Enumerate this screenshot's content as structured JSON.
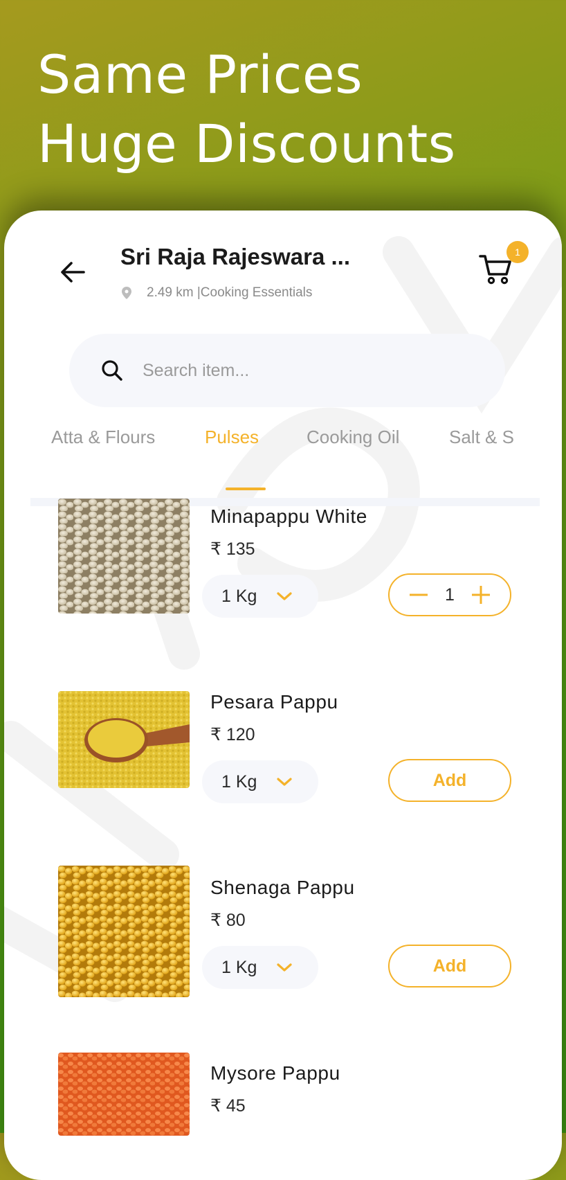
{
  "headline": {
    "line1": "Same Prices",
    "line2": "Huge Discounts"
  },
  "header": {
    "store_name": "Sri Raja Rajeswara ...",
    "store_meta": "2.49 km |Cooking Essentials",
    "cart_count": "1"
  },
  "search": {
    "placeholder": "Search item...",
    "value": ""
  },
  "tabs": [
    {
      "label": "Atta & Flours",
      "active": false
    },
    {
      "label": "Pulses",
      "active": true
    },
    {
      "label": "Cooking Oil",
      "active": false
    },
    {
      "label": "Salt & S",
      "active": false
    }
  ],
  "products": [
    {
      "name": "Minapappu White",
      "price": "₹ 135",
      "size": "1 Kg",
      "quantity": "1",
      "in_cart": true,
      "image": "white-urad-dal"
    },
    {
      "name": "Pesara Pappu",
      "price": "₹ 120",
      "size": "1 Kg",
      "add_label": "Add",
      "in_cart": false,
      "image": "moong-dal-with-spoon"
    },
    {
      "name": "Shenaga Pappu",
      "price": "₹ 80",
      "size": "1 Kg",
      "add_label": "Add",
      "in_cart": false,
      "image": "chana-dal"
    },
    {
      "name": "Mysore Pappu",
      "price": "₹ 45",
      "image": "masoor-dal"
    }
  ],
  "colors": {
    "accent": "#f4b22a",
    "text": "#1b1b1b",
    "muted": "#9a9a9a",
    "field_bg": "#f6f7fb",
    "bg_gradient_start": "#a59a1e",
    "bg_gradient_end": "#3c9012"
  },
  "icons": {
    "back": "arrow-left-icon",
    "cart": "cart-icon",
    "pin": "location-pin-icon",
    "search": "search-icon",
    "dropdown": "chevron-down-icon",
    "minus": "minus-icon",
    "plus": "plus-icon"
  }
}
